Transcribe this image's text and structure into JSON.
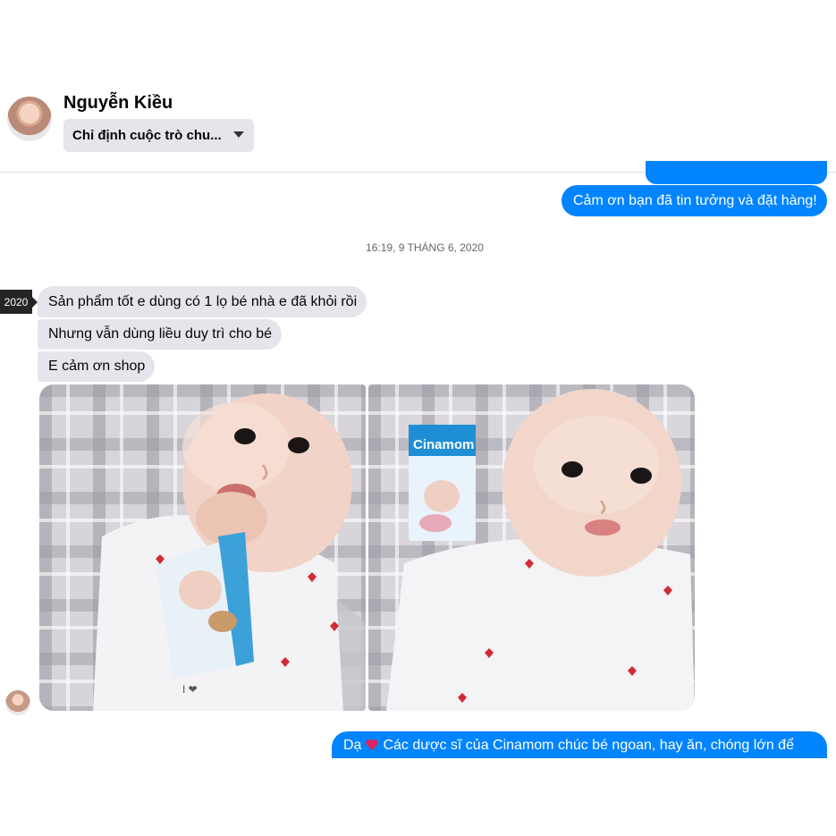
{
  "header": {
    "contact_name": "Nguyễn Kiều",
    "conversation_select": "Chỉ định cuộc trò chu..."
  },
  "messages": {
    "top_partial": "",
    "outgoing_1": "Cảm ơn bạn đã tin tưởng và đặt hàng!",
    "timestamp": "16:19, 9 THÁNG 6, 2020",
    "year_tag": "2020",
    "incoming": [
      "Sản phẩm tốt e dùng có 1 lọ bé nhà e đã khỏi rồi",
      "Nhưng vẫn dùng liều duy trì cho bé",
      "E cảm ơn shop"
    ],
    "product_box": {
      "brand": "Cinamom"
    },
    "outgoing_2_prefix": "Dạ",
    "outgoing_2_icon": "heart-icon",
    "outgoing_2_text": "Các dược sĩ của Cinamom chúc bé ngoan, hay ăn, chóng lớn để"
  },
  "colors": {
    "outgoing_bubble": "#0084ff",
    "incoming_bubble": "#e4e6eb",
    "heart": "#e0245e"
  }
}
